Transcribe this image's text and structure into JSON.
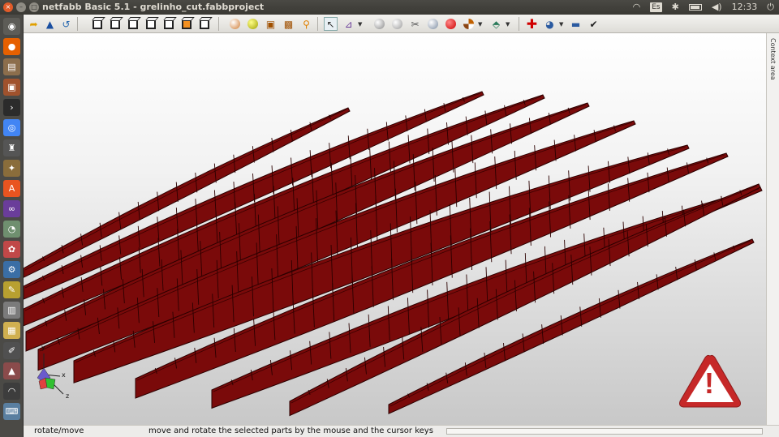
{
  "window": {
    "title": "netfabb Basic 5.1 - grelinho_cut.fabbproject",
    "close_glyph": "×",
    "minimize_glyph": "–",
    "maximize_glyph": "□"
  },
  "system_tray": {
    "keyboard_layout": "Es",
    "clock": "12:33",
    "wifi_glyph": "◠",
    "bluetooth_glyph": "✱",
    "volume_glyph": "◀)",
    "power_glyph": "⏻"
  },
  "launcher": {
    "items": [
      "dash-home",
      "firefox",
      "files-manager",
      "archive",
      "terminal",
      "chromium",
      "inkscape",
      "gimp",
      "software-center",
      "arduino",
      "disk-utility",
      "color-picker",
      "system-settings",
      "notes",
      "trash-like",
      "text-editor",
      "pen-tool",
      "install-icon",
      "wireless",
      "keyboard"
    ]
  },
  "toolbar": {
    "tools": [
      "open-project",
      "add-part",
      "undo",
      "view-front",
      "view-back",
      "view-left",
      "view-right",
      "view-top",
      "view-bottom",
      "colors",
      "mesh-shaded",
      "wireframe",
      "texture",
      "zoom",
      "select-move",
      "measure",
      "sphere-view",
      "camera",
      "cuts",
      "repair",
      "material-ball",
      "section",
      "slice",
      "add-red-plus",
      "mesh-repair",
      "ruler",
      "checkmark"
    ]
  },
  "context_area": {
    "label": "Context area"
  },
  "status": {
    "mode": "rotate/move",
    "message": "move and rotate the selected parts by the mouse and the cursor keys"
  },
  "gizmo": {
    "x": "x",
    "y": "y",
    "z": "z"
  },
  "warning": {
    "glyph": "!"
  },
  "colors": {
    "part_fill": "#7a0a0a",
    "part_edge": "#2b0000",
    "warning_red": "#c62828"
  }
}
